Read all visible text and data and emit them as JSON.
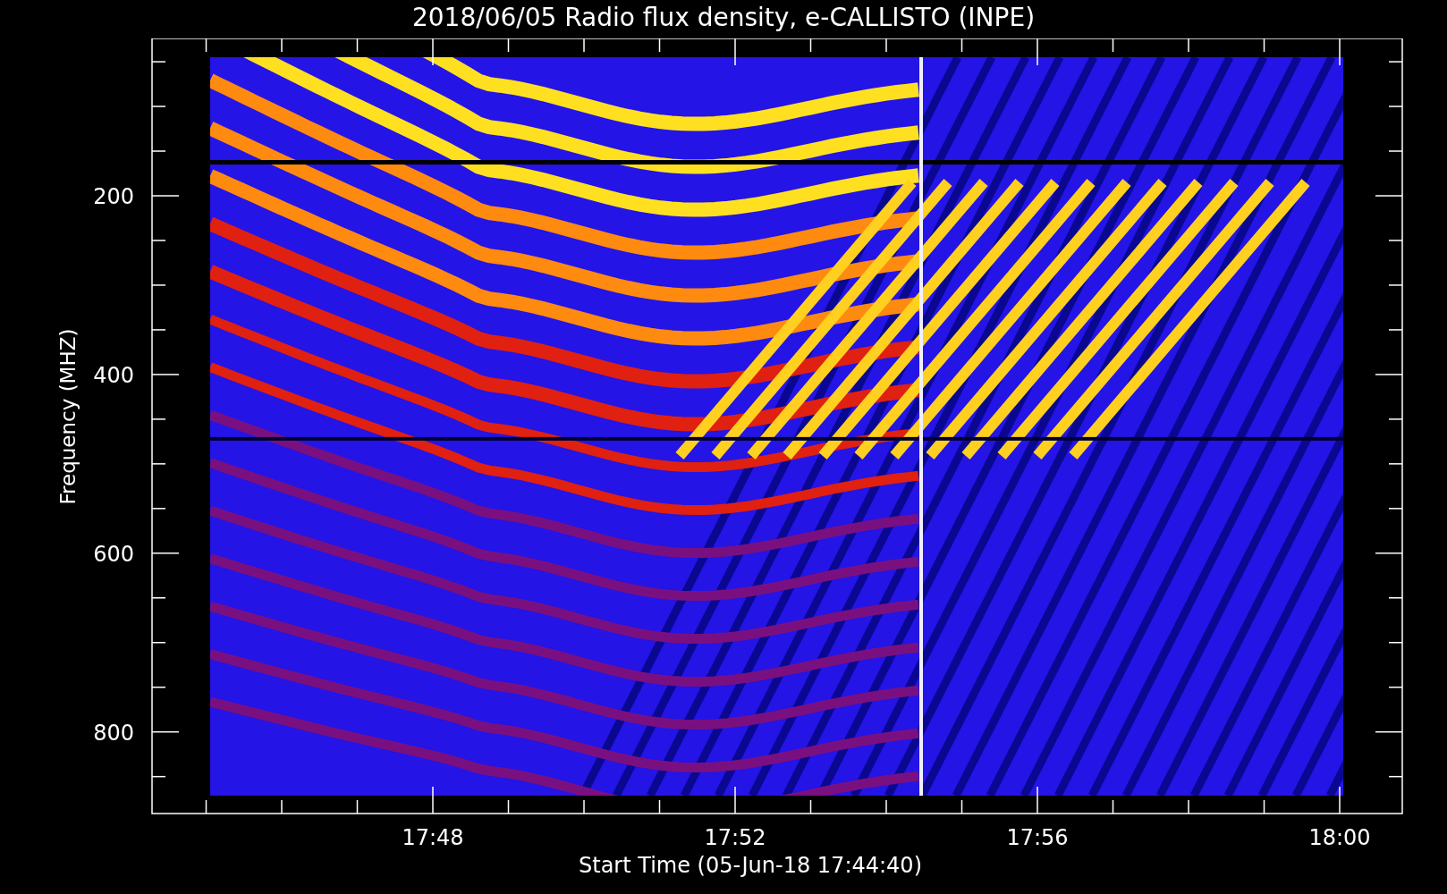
{
  "title": "2018/06/05  Radio flux density, e-CALLISTO (INPE)",
  "y_axis": {
    "title": "Frequency (MHZ)",
    "tick_labels": [
      "200",
      "400",
      "600",
      "800"
    ]
  },
  "x_axis": {
    "title": "Start Time (05-Jun-18 17:44:40)",
    "tick_labels": [
      "17:48",
      "17:52",
      "17:56",
      "18:00"
    ]
  }
}
